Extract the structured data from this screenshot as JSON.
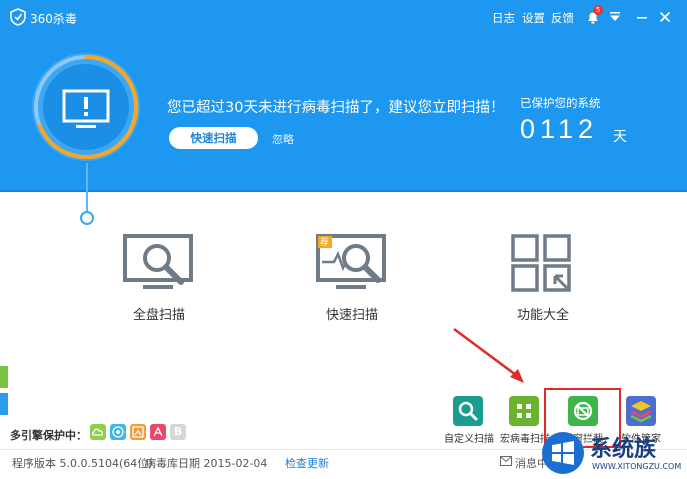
{
  "titlebar": {
    "app_title": "360杀毒",
    "log": "日志",
    "settings": "设置",
    "feedback": "反馈",
    "notify_badge": "5"
  },
  "status": {
    "headline": "您已超过30天未进行病毒扫描了，建议您立即扫描！",
    "scan_button": "快速扫描",
    "ignore": "忽略",
    "protected_label": "已保护您的系统",
    "days": "0112",
    "days_unit": "天"
  },
  "actions": [
    {
      "label": "全盘扫描"
    },
    {
      "label": "快速扫描",
      "badge": "荐"
    },
    {
      "label": "功能大全"
    }
  ],
  "tools": [
    {
      "label": "自定义扫描",
      "color": "#1a9c8f"
    },
    {
      "label": "宏病毒扫描",
      "color": "#6ab42d"
    },
    {
      "label": "弹窗拦截",
      "color": "#3db54a"
    },
    {
      "label": "软件管家",
      "color": "#4a6fd0"
    }
  ],
  "engines": {
    "label": "多引擎保护中：",
    "items": [
      "cloud-engine-icon",
      "qvm-engine-icon",
      "system-repair-engine-icon",
      "avira-engine-icon",
      "bitdefender-engine-icon"
    ],
    "bitdefender_letter": "B"
  },
  "footer": {
    "version": "程序版本 5.0.0.5104(64位)",
    "db_date": "病毒库日期 2015-02-04",
    "check_update": "检查更新",
    "messages": "消息中"
  },
  "watermark": {
    "brand": "系统族",
    "url": "WWW.XITONGZU.COM"
  },
  "colors": {
    "header_blue": "#1e97f0",
    "ring_orange": "#f5a623",
    "annotation_red": "#e12a2a"
  }
}
